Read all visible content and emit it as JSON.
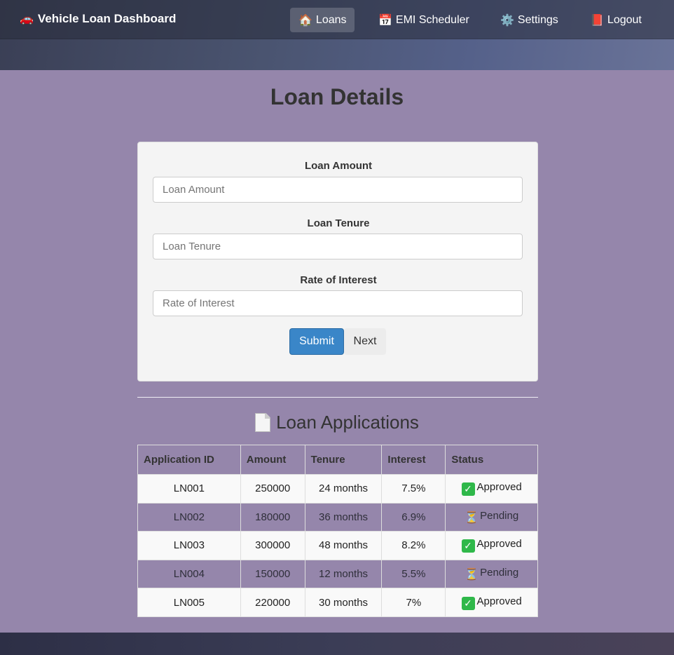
{
  "navbar": {
    "brand": {
      "icon": "car-icon",
      "label": "Vehicle Loan Dashboard",
      "glyph": "🚗"
    },
    "items": [
      {
        "id": "loans",
        "label": "Loans",
        "icon": "house-icon",
        "glyph": "🏠",
        "active": true
      },
      {
        "id": "emi",
        "label": "EMI Scheduler",
        "icon": "calendar-icon",
        "glyph": "📅",
        "active": false
      },
      {
        "id": "settings",
        "label": "Settings",
        "icon": "gear-icon",
        "glyph": "⚙️",
        "active": false
      },
      {
        "id": "logout",
        "label": "Logout",
        "icon": "book-icon",
        "glyph": "📕",
        "active": false
      }
    ]
  },
  "page": {
    "title": "Loan Details"
  },
  "form": {
    "amount": {
      "label": "Loan Amount",
      "placeholder": "Loan Amount",
      "value": ""
    },
    "tenure": {
      "label": "Loan Tenure",
      "placeholder": "Loan Tenure",
      "value": ""
    },
    "interest": {
      "label": "Rate of Interest",
      "placeholder": "Rate of Interest",
      "value": ""
    },
    "submit_label": "Submit",
    "next_label": "Next"
  },
  "applications": {
    "title": "Loan Applications",
    "icon": "document-icon",
    "columns": [
      "Application ID",
      "Amount",
      "Tenure",
      "Interest",
      "Status"
    ],
    "rows": [
      {
        "id": "LN001",
        "amount": "250000",
        "tenure": "24 months",
        "interest": "7.5%",
        "status": "Approved",
        "status_icon": "check-icon"
      },
      {
        "id": "LN002",
        "amount": "180000",
        "tenure": "36 months",
        "interest": "6.9%",
        "status": "Pending",
        "status_icon": "hourglass-icon"
      },
      {
        "id": "LN003",
        "amount": "300000",
        "tenure": "48 months",
        "interest": "8.2%",
        "status": "Approved",
        "status_icon": "check-icon"
      },
      {
        "id": "LN004",
        "amount": "150000",
        "tenure": "12 months",
        "interest": "5.5%",
        "status": "Pending",
        "status_icon": "hourglass-icon"
      },
      {
        "id": "LN005",
        "amount": "220000",
        "tenure": "30 months",
        "interest": "7%",
        "status": "Approved",
        "status_icon": "check-icon"
      }
    ]
  },
  "colors": {
    "background": "#9586ab",
    "accent": "#3a86c8",
    "approved": "#2fb84a"
  }
}
